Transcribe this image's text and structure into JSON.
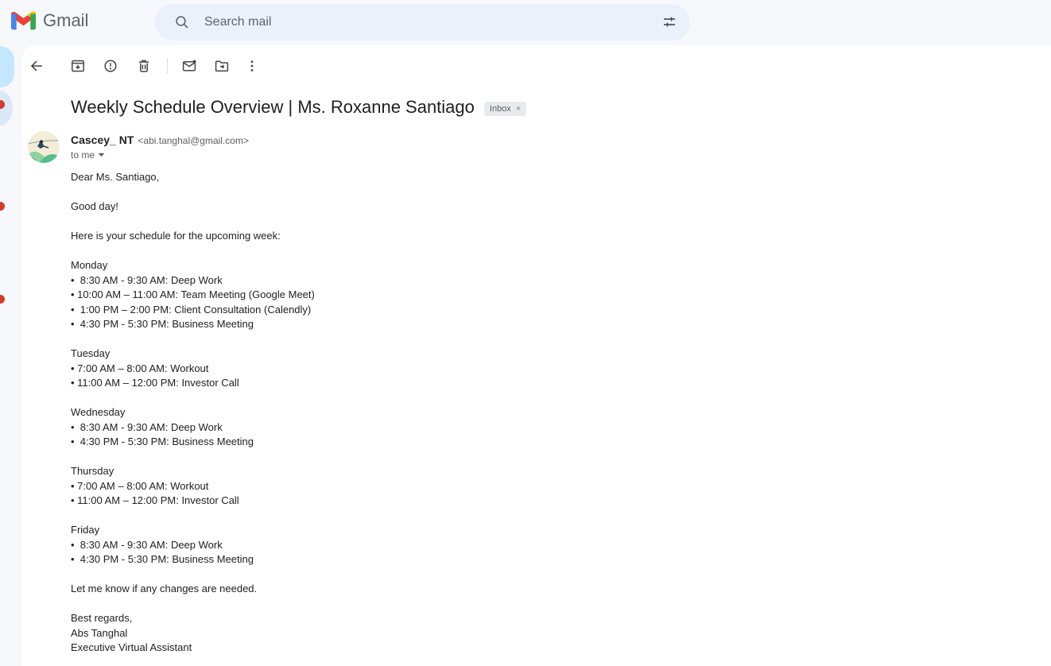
{
  "header": {
    "brand": "Gmail",
    "search_placeholder": "Search mail"
  },
  "toolbar": {
    "icons": [
      "back-icon",
      "archive-icon",
      "report-spam-icon",
      "delete-icon",
      "mark-unread-icon",
      "move-to-icon",
      "more-vert-icon"
    ]
  },
  "email": {
    "subject": "Weekly Schedule Overview | Ms. Roxanne Santiago",
    "label_text": "Inbox",
    "label_remove": "×",
    "sender_name": "Cascey_ NT",
    "sender_address": "<abi.tanghal@gmail.com>",
    "to_line": "to me",
    "body": [
      {
        "lines": [
          "Dear Ms. Santiago,"
        ]
      },
      {
        "lines": [
          "Good day!"
        ]
      },
      {
        "lines": [
          "Here is your schedule for the upcoming week:"
        ]
      },
      {
        "lines": [
          "Monday",
          "•  8:30 AM - 9:30 AM: Deep Work",
          "• 10:00 AM – 11:00 AM: Team Meeting (Google Meet)",
          "•  1:00 PM – 2:00 PM: Client Consultation (Calendly)",
          "•  4:30 PM - 5:30 PM: Business Meeting"
        ]
      },
      {
        "lines": [
          "Tuesday",
          "• 7:00 AM – 8:00 AM: Workout",
          "• 11:00 AM – 12:00 PM: Investor Call"
        ]
      },
      {
        "lines": [
          "Wednesday",
          "•  8:30 AM - 9:30 AM: Deep Work",
          "•  4:30 PM - 5:30 PM: Business Meeting"
        ]
      },
      {
        "lines": [
          "Thursday",
          "• 7:00 AM – 8:00 AM: Workout",
          "• 11:00 AM – 12:00 PM: Investor Call"
        ]
      },
      {
        "lines": [
          "Friday",
          "•  8:30 AM - 9:30 AM: Deep Work",
          "•  4:30 PM - 5:30 PM: Business Meeting"
        ]
      },
      {
        "lines": [
          "Let me know if any changes are needed."
        ]
      },
      {
        "lines": [
          "Best regards,",
          "Abs Tanghal",
          "Executive Virtual Assistant"
        ]
      }
    ]
  },
  "colors": {
    "header_bg": "#f6f8fc",
    "search_bg": "#eaf1fb",
    "panel_bg": "#ffffff",
    "rail_pill_blue": "#c2e7ff",
    "rail_dot_red": "#d33a2c",
    "chip_bg": "#e8eaed",
    "icon_gray": "#444746",
    "gmail_blue": "#4285f4",
    "gmail_red": "#ea4335",
    "gmail_yellow": "#fbbc04",
    "gmail_green": "#34a853"
  }
}
